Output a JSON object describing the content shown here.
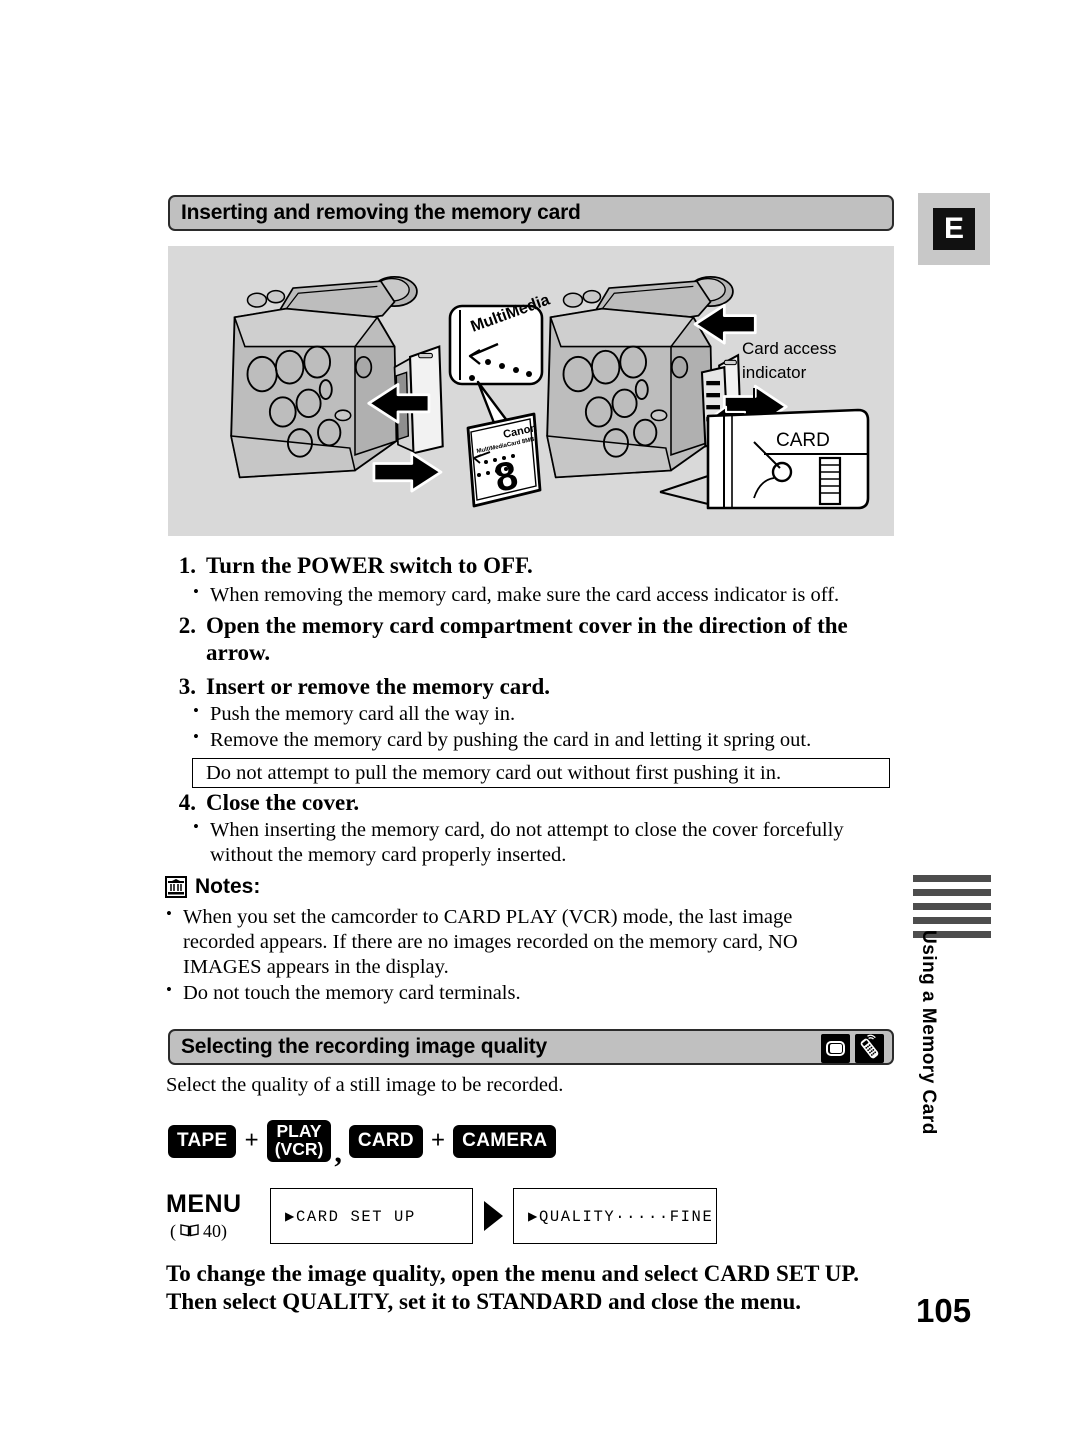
{
  "page": {
    "language_tab": "E",
    "page_number": "105",
    "thumb_index_label": "Using a Memory Card"
  },
  "section_insert": {
    "title": "Inserting and removing the memory card",
    "illustration": {
      "callout_card_label": "MultiMedia",
      "card_brand": "Canon",
      "card_capacity": "8",
      "card_type_text": "MultiMediaCard",
      "access_indicator_label_line1": "Card access",
      "access_indicator_label_line2": "indicator",
      "card_slot_label": "CARD"
    },
    "steps": [
      {
        "num": "1.",
        "text": "Turn the POWER switch to OFF.",
        "bullets": [
          "When removing the memory card, make sure the card access indicator is off."
        ]
      },
      {
        "num": "2.",
        "text": "Open the memory card compartment cover in the direction of the arrow.",
        "bullets": []
      },
      {
        "num": "3.",
        "text": "Insert or remove the memory card.",
        "bullets": [
          "Push the memory card all the way in.",
          "Remove the memory card by pushing the card in and letting it spring out."
        ]
      },
      {
        "num": "4.",
        "text": "Close the cover.",
        "bullets": [
          "When inserting the memory card, do not attempt to close the cover forcefully without the memory card properly inserted."
        ]
      }
    ],
    "warning_box": "Do not attempt to pull the memory card out without first pushing it in.",
    "notes": {
      "heading": "Notes:",
      "items": [
        "When you set the camcorder to CARD PLAY (VCR) mode, the last image recorded appears. If there are no images recorded on the memory card, NO IMAGES appears in the display.",
        "Do not touch the memory card terminals."
      ]
    }
  },
  "section_quality": {
    "title": "Selecting the recording image quality",
    "mode_icons": [
      "card-play-icon",
      "remote-control-icon"
    ],
    "lead": "Select the quality of a still image to be recorded.",
    "keys": [
      {
        "kind": "single",
        "label": "TAPE"
      },
      {
        "kind": "operator",
        "label": "+"
      },
      {
        "kind": "dual",
        "line1": "PLAY",
        "line2": "(VCR)"
      },
      {
        "kind": "comma",
        "label": ","
      },
      {
        "kind": "single",
        "label": "CARD"
      },
      {
        "kind": "operator",
        "label": "+"
      },
      {
        "kind": "single",
        "label": "CAMERA"
      }
    ],
    "menu": {
      "label": "MENU",
      "reference_open": "(",
      "reference_page": "40)",
      "box1": "CARD SET UP",
      "box2": "QUALITY·····FINE"
    },
    "closing": "To change the image quality, open the menu and select CARD SET UP. Then select QUALITY, set it to STANDARD and close the menu."
  }
}
